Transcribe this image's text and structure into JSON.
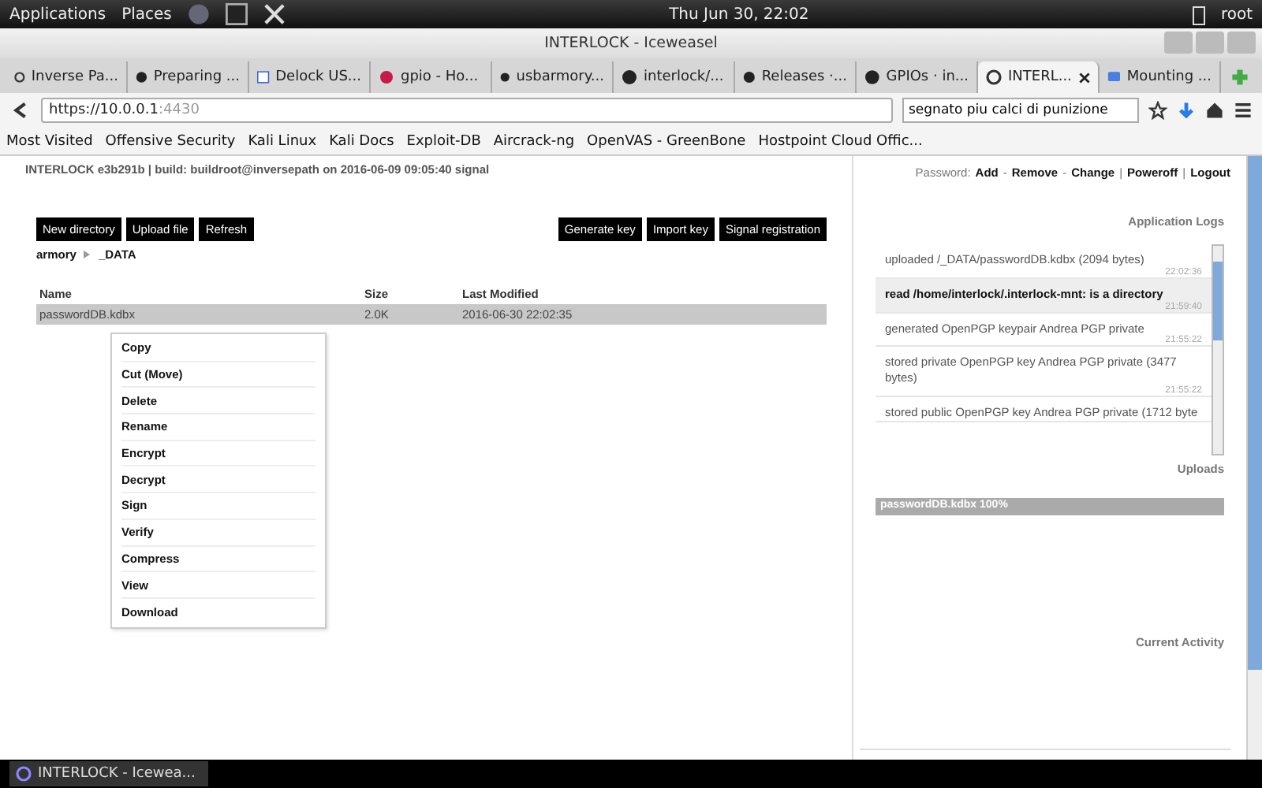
{
  "top_panel": {
    "menus": [
      "Applications",
      "Places"
    ],
    "clock": "Thu Jun 30, 22:02",
    "user": "root"
  },
  "window": {
    "title": "INTERLOCK - Iceweasel"
  },
  "tabs": [
    {
      "label": "Inverse Pa...",
      "kind": "ring",
      "selected": false
    },
    {
      "label": "Preparing ...",
      "kind": "octocat",
      "selected": false
    },
    {
      "label": "Delock US...",
      "kind": "square",
      "selected": false
    },
    {
      "label": "gpio - Ho...",
      "kind": "berry",
      "selected": false
    },
    {
      "label": "usbarmory...",
      "kind": "octocat",
      "selected": false
    },
    {
      "label": "interlock/...",
      "kind": "octocat",
      "selected": false
    },
    {
      "label": "Releases ·...",
      "kind": "octocat",
      "selected": false
    },
    {
      "label": "GPIOs · in...",
      "kind": "octocat",
      "selected": false
    },
    {
      "label": "INTERL...",
      "kind": "ring",
      "selected": true
    },
    {
      "label": "Mounting ...",
      "kind": "bubble",
      "selected": false
    }
  ],
  "address_bar": {
    "host": "https://10.0.0.1",
    "port": ":4430"
  },
  "search": {
    "value": "segnato piu calci di punizione"
  },
  "bookmarks": [
    "Most Visited",
    "Offensive Security",
    "Kali Linux",
    "Kali Docs",
    "Exploit-DB",
    "Aircrack-ng",
    "OpenVAS - GreenBone",
    "Hostpoint Cloud Offic..."
  ],
  "page": {
    "build_info": "INTERLOCK e3b291b | build: buildroot@inversepath on 2016-06-09 09:05:40 signal",
    "account_links": {
      "label": "Password:",
      "links": [
        "Add",
        "Remove",
        "Change",
        "Poweroff",
        "Logout"
      ],
      "separators": [
        "-",
        "-",
        "|",
        "|"
      ]
    },
    "left_buttons": [
      "New directory",
      "Upload file",
      "Refresh"
    ],
    "right_buttons": [
      "Generate key",
      "Import key",
      "Signal registration"
    ],
    "breadcrumb": [
      "armory",
      "_DATA"
    ],
    "table": {
      "columns": [
        "Name",
        "Size",
        "Last Modified"
      ],
      "rows": [
        {
          "name": "passwordDB.kdbx",
          "size": "2.0K",
          "modified": "2016-06-30 22:02:35",
          "selected": true
        }
      ]
    },
    "context_menu": [
      "Copy",
      "Cut (Move)",
      "Delete",
      "Rename",
      "Encrypt",
      "Decrypt",
      "Sign",
      "Verify",
      "Compress",
      "View",
      "Download"
    ],
    "logs_title": "Application Logs",
    "logs": [
      {
        "text": "uploaded /_DATA/passwordDB.kdbx (2094 bytes)",
        "time": "22:02:36",
        "highlighted": false
      },
      {
        "text": "read /home/interlock/.interlock-mnt: is a directory",
        "time": "21:59:40",
        "highlighted": true
      },
      {
        "text": "generated OpenPGP keypair Andrea PGP private",
        "time": "21:55:22",
        "highlighted": false
      },
      {
        "text": "stored private OpenPGP key Andrea PGP private (3477 bytes)",
        "time": "21:55:22",
        "highlighted": false
      },
      {
        "text": "stored public OpenPGP key Andrea PGP private (1712 byte",
        "highlighted": false
      }
    ],
    "uploads_title": "Uploads",
    "uploads": [
      {
        "label": "passwordDB.kdbx 100%",
        "level": 1
      }
    ],
    "activity_title": "Current Activity"
  },
  "taskbar": {
    "window": "INTERLOCK - Icewea..."
  }
}
